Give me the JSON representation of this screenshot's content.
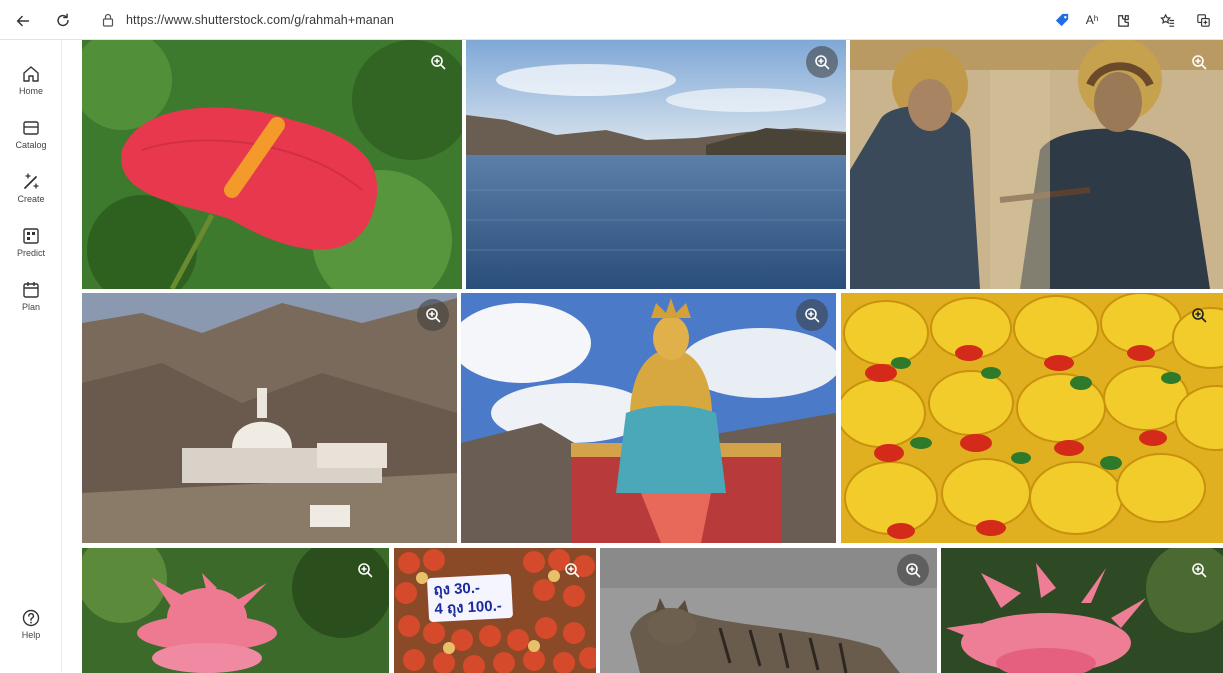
{
  "browser": {
    "url": "https://www.shutterstock.com/g/rahmah+manan",
    "icons": [
      "back-arrow-icon",
      "refresh-icon",
      "lock-icon",
      "tag-icon",
      "read-aloud-icon",
      "extension-icon",
      "favorites-icon",
      "collections-icon"
    ],
    "read_aloud_label": "Aʰ"
  },
  "sidebar": {
    "items": [
      {
        "label": "Home",
        "icon": "home-icon"
      },
      {
        "label": "Catalog",
        "icon": "catalog-icon"
      },
      {
        "label": "Create",
        "icon": "create-icon"
      },
      {
        "label": "Predict",
        "icon": "predict-icon"
      },
      {
        "label": "Plan",
        "icon": "plan-icon"
      }
    ],
    "help": {
      "label": "Help",
      "icon": "help-icon"
    }
  },
  "images": [
    {
      "subject": "red anthurium flower"
    },
    {
      "subject": "mountain lake"
    },
    {
      "subject": "byzantine mosaic"
    },
    {
      "subject": "shanti stupa on mountain"
    },
    {
      "subject": "golden buddha statue"
    },
    {
      "subject": "yellow food with red chili"
    },
    {
      "subject": "pink torch ginger flower"
    },
    {
      "subject": "strawberries with price sign",
      "sign_line1": "ถุง 30.-",
      "sign_line2": "4 ถุง 100.-"
    },
    {
      "subject": "tabby cat on road"
    },
    {
      "subject": "pink torch ginger flower"
    }
  ],
  "colors": {
    "accent_blue": "#1f6fe0",
    "zoom_bg": "#3c3c3c"
  }
}
